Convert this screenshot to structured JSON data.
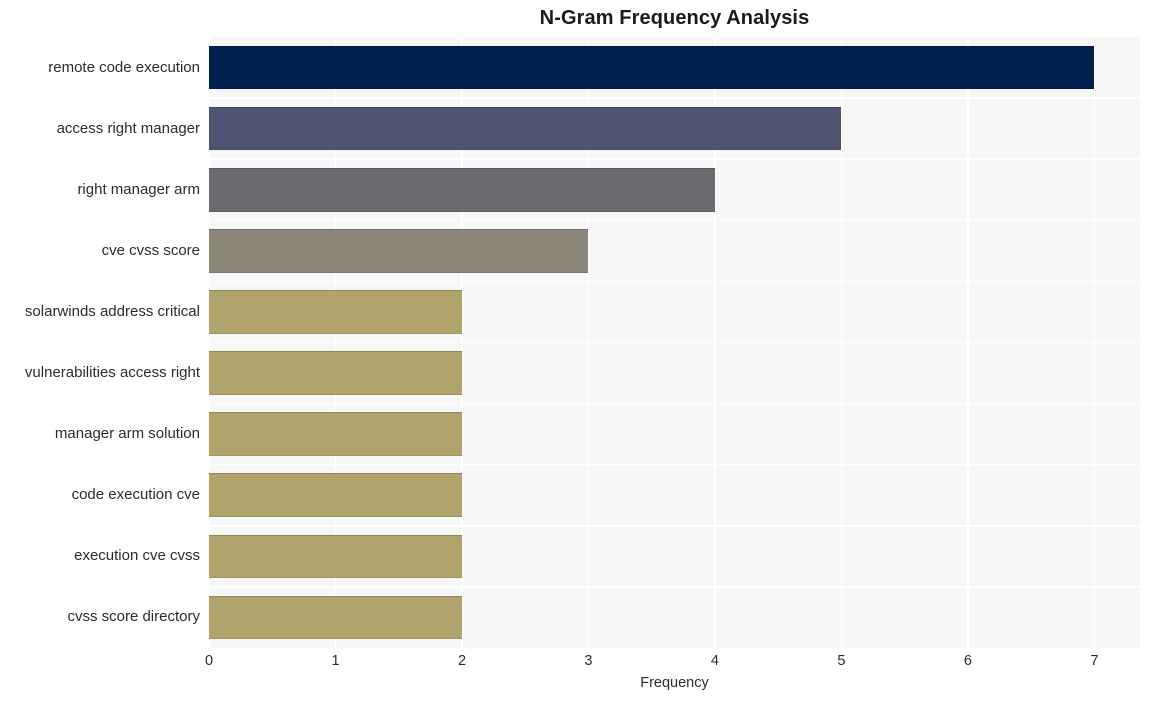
{
  "chart_data": {
    "type": "bar",
    "orientation": "horizontal",
    "title": "N-Gram Frequency Analysis",
    "xlabel": "Frequency",
    "ylabel": "",
    "categories": [
      "remote code execution",
      "access right manager",
      "right manager arm",
      "cve cvss score",
      "solarwinds address critical",
      "vulnerabilities access right",
      "manager arm solution",
      "code execution cve",
      "execution cve cvss",
      "cvss score directory"
    ],
    "values": [
      7,
      5,
      4,
      3,
      2,
      2,
      2,
      2,
      2,
      2
    ],
    "bar_colors": [
      "#002050",
      "#4d5370",
      "#696b71",
      "#8d877b",
      "#b0a46c",
      "#b0a46c",
      "#b0a46c",
      "#b0a46c",
      "#b0a46c",
      "#b0a46c"
    ],
    "xlim": [
      0,
      7.36
    ],
    "ylim": [
      0,
      10
    ],
    "xticks": [
      0,
      1,
      2,
      3,
      4,
      5,
      6,
      7
    ],
    "xtick_labels": [
      "0",
      "1",
      "2",
      "3",
      "4",
      "5",
      "6",
      "7"
    ],
    "grid": true,
    "grid_color": "#ffffff",
    "plot_background": "#f7f7f7",
    "figure_background": "#ffffff",
    "legend": null
  }
}
